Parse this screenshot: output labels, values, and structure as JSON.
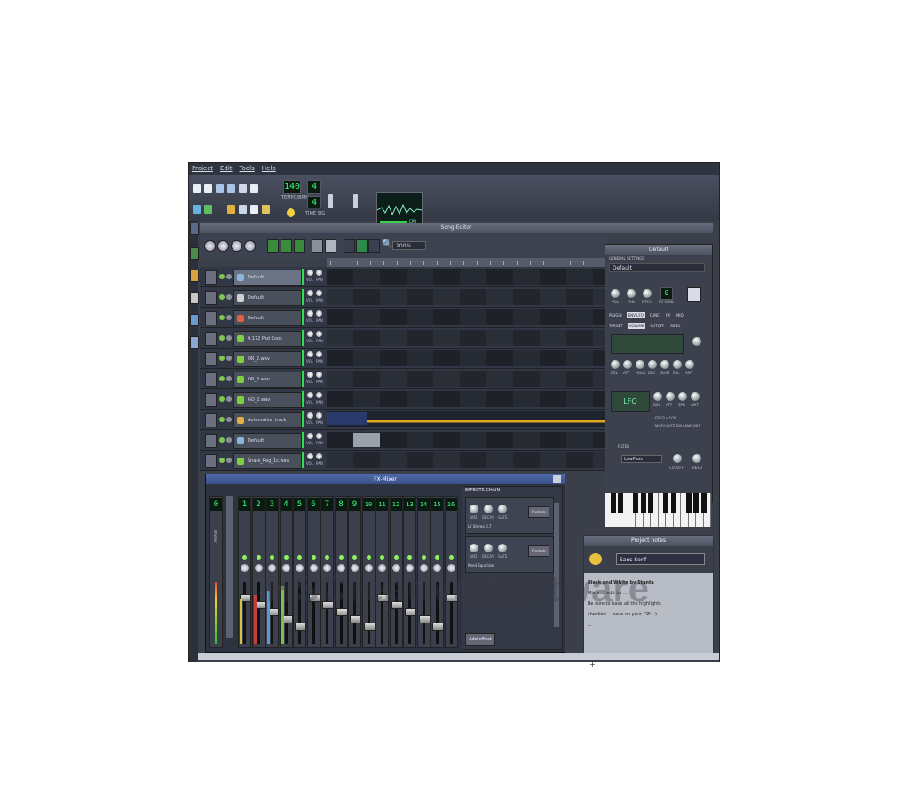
{
  "menu": [
    "Project",
    "Edit",
    "Tools",
    "Help"
  ],
  "toolbar": {
    "tempo": "140",
    "tempo_label": "TEMPO/BPM",
    "time_sig": "4",
    "time_sig_label": "TIME SIG",
    "cpu_label": "CPU"
  },
  "song_editor": {
    "title": "Song-Editor",
    "zoom": "200%",
    "tracks": [
      {
        "name": "Default",
        "icon": "instrument-icon",
        "color": "#8ab8d8",
        "selected": true
      },
      {
        "name": "Default",
        "icon": "instrument-icon",
        "color": "#d0d0d0"
      },
      {
        "name": "Default",
        "icon": "instrument-icon",
        "color": "#e06040"
      },
      {
        "name": "0.172 Pad Coos",
        "icon": "note-icon",
        "color": "#7ed040"
      },
      {
        "name": "OR_2.wav",
        "icon": "note-icon",
        "color": "#7ed040"
      },
      {
        "name": "OR_3.wav",
        "icon": "note-icon",
        "color": "#7ed040"
      },
      {
        "name": "GO_2.wav",
        "icon": "note-icon",
        "color": "#7ed040"
      },
      {
        "name": "Automation track",
        "icon": "folder-icon",
        "color": "#e0b040"
      },
      {
        "name": "Default",
        "icon": "instrument-icon",
        "color": "#8ab8d8"
      },
      {
        "name": "Snare_Reg_1c.wav",
        "icon": "note-icon",
        "color": "#7ed040"
      }
    ],
    "knob_labels": [
      "VOL",
      "PAN"
    ]
  },
  "instrument": {
    "title": "Default",
    "section": "GENERAL SETTINGS",
    "name": "Default",
    "knobs": [
      "VOL",
      "PAN",
      "PITCH"
    ],
    "fx_label": "FX CHNL",
    "fx_value": "0",
    "tabs": [
      "PLUGIN",
      "ENV/LFO",
      "FUNC",
      "FX",
      "MIDI"
    ],
    "subtabs": [
      "TARGET",
      "VOLUME",
      "CUTOFF",
      "RESO"
    ],
    "env_knobs": [
      "DEL",
      "ATT",
      "HOLD",
      "DEC",
      "SUST",
      "REL",
      "AMT"
    ],
    "lfo_knobs": [
      "DEL",
      "ATT",
      "SPD",
      "AMT"
    ],
    "lfo_label": "LFO",
    "freq_label": "FREQ x 100",
    "modulate_label": "MODULATE ENV AMOUNT",
    "filter_label": "FILTER",
    "filter_type": "LowPass",
    "filter_knobs": [
      "CUTOFF",
      "RESO"
    ]
  },
  "fxmixer": {
    "title": "FX-Mixer",
    "channels": [
      "0",
      "1",
      "2",
      "3",
      "4",
      "5",
      "6",
      "7",
      "8",
      "9",
      "10",
      "11",
      "12",
      "13",
      "14",
      "15",
      "16"
    ],
    "master_label": "Master",
    "fx_chain": {
      "header": "EFFECTS CHAIN",
      "slots": [
        {
          "name": "LV Stereo 0.7",
          "controls": "Controls"
        },
        {
          "name": "Reed Equalizer",
          "controls": "Controls"
        }
      ],
      "knob_labels": [
        "W/D",
        "DECAY",
        "GATE"
      ],
      "add_label": "Add effect"
    }
  },
  "project_notes": {
    "title": "Project notes",
    "font": "Sans Serif",
    "lines": [
      "Black and White by Stanta",
      "Mix and edit by ...",
      "Be sure to have all the highlights",
      "checked ... save on your CPU :)",
      "..."
    ]
  },
  "watermark": "HSCreative Software"
}
